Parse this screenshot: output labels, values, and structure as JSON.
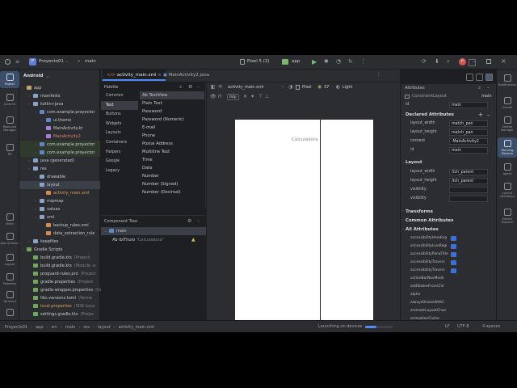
{
  "topbar": {
    "project": "Proyecto01",
    "branch": "main",
    "device": "Pixel 5 (2)",
    "run_config": "app"
  },
  "left_tools": [
    "Project",
    "Commit",
    "Resource Manager",
    "PR",
    "Build",
    "App Quality I",
    "Logcat",
    "Problems",
    "Terminal",
    "Version Control"
  ],
  "right_tools": [
    "Notifications",
    "Gradle",
    "Device Manager",
    "Running Devices",
    "Agent",
    "Layout Validation",
    "Device Explorer"
  ],
  "project_panel": {
    "view": "Android",
    "items": [
      {
        "label": "app",
        "indent": 0,
        "icon": "fld-y"
      },
      {
        "label": "manifests",
        "indent": 1,
        "icon": "fld"
      },
      {
        "label": "kotlin+java",
        "indent": 1,
        "icon": "fld"
      },
      {
        "label": "com.example.proyector",
        "indent": 2,
        "icon": "pkg"
      },
      {
        "label": "ui.theme",
        "indent": 3,
        "icon": "pkg"
      },
      {
        "label": "MainActivity.kt",
        "indent": 3,
        "icon": "fkt"
      },
      {
        "label": "MainActivity2",
        "indent": 3,
        "icon": "fkt",
        "highlight": "red"
      },
      {
        "label": "com.example.proyector",
        "indent": 2,
        "icon": "pkg",
        "highlight": "green"
      },
      {
        "label": "com.example.proyector",
        "indent": 2,
        "icon": "pkg",
        "highlight": "green"
      },
      {
        "label": "java (generated)",
        "indent": 1,
        "icon": "fld"
      },
      {
        "label": "res",
        "indent": 1,
        "icon": "fld"
      },
      {
        "label": "drawable",
        "indent": 2,
        "icon": "fld"
      },
      {
        "label": "layout",
        "indent": 2,
        "icon": "fld",
        "selected": true
      },
      {
        "label": "activity_main.xml",
        "indent": 3,
        "icon": "fxml",
        "color": "orange"
      },
      {
        "label": "mipmap",
        "indent": 2,
        "icon": "fld"
      },
      {
        "label": "values",
        "indent": 2,
        "icon": "fld"
      },
      {
        "label": "xml",
        "indent": 2,
        "icon": "fld"
      },
      {
        "label": "backup_rules.xml",
        "indent": 3,
        "icon": "fxml"
      },
      {
        "label": "data_extraction_rule",
        "indent": 3,
        "icon": "fxml"
      },
      {
        "label": "keepfiles",
        "indent": 1,
        "icon": "fld"
      },
      {
        "label": "Gradle Scripts",
        "indent": 0,
        "icon": "fgr"
      },
      {
        "label": "build.gradle.kts",
        "indent": 1,
        "icon": "fgr",
        "note": "(Project:"
      },
      {
        "label": "build.gradle.kts",
        "indent": 1,
        "icon": "fgr",
        "note": "(Module :a"
      },
      {
        "label": "proguard-rules.pro",
        "indent": 1,
        "icon": "fgr",
        "note": "(Project"
      },
      {
        "label": "gradle.properties",
        "indent": 1,
        "icon": "fgr",
        "note": "(Project"
      },
      {
        "label": "gradle-wrapper.properties",
        "indent": 1,
        "icon": "fgr",
        "note": "(Gr"
      },
      {
        "label": "libs.versions.toml",
        "indent": 1,
        "icon": "fgr",
        "note": "(Versio"
      },
      {
        "label": "local.properties",
        "indent": 1,
        "icon": "fgr",
        "note": "(SDK Loca",
        "color": "orange"
      },
      {
        "label": "settings.gradle.kts",
        "indent": 1,
        "icon": "fgr",
        "note": "(Projec"
      }
    ]
  },
  "tabs": [
    {
      "label": "activity_main.xml",
      "active": true
    },
    {
      "label": "MainActivity2.java",
      "active": false
    }
  ],
  "palette": {
    "title": "Palette",
    "categories": [
      "Common",
      "Text",
      "Buttons",
      "Widgets",
      "Layouts",
      "Containers",
      "Helpers",
      "Google",
      "Legacy"
    ],
    "active_category": 1,
    "items": [
      "Ab TextView",
      "Plain Text",
      "Password",
      "Password (Numeric)",
      "E-mail",
      "Phone",
      "Postal Address",
      "Multiline Text",
      "Time",
      "Date",
      "Number",
      "Number (Signed)",
      "Number (Decimal)"
    ]
  },
  "design_toolbar": {
    "file": "activity_main.xml",
    "device": "Pixel",
    "api": "37",
    "theme": "Light",
    "margin": "0dp"
  },
  "component_tree": {
    "title": "Component Tree",
    "root": "main",
    "child_label": "Ab lblTitulo",
    "child_text": "\"Calculadora\""
  },
  "canvas": {
    "label_text": "Calculadora"
  },
  "attributes": {
    "title": "Attributes",
    "class_name": "ConstraintLayout",
    "class_id": "main",
    "id_label": "id",
    "id_value": "main",
    "declared_title": "Declared Attributes",
    "declared": [
      {
        "name": "layout_width",
        "value": "match_pan"
      },
      {
        "name": "layout_height",
        "value": "match_pan"
      },
      {
        "name": "context",
        "value": ".MainActivity2"
      },
      {
        "name": "id",
        "value": "main"
      }
    ],
    "layout_title": "Layout",
    "layout": [
      {
        "name": "layout_width",
        "value": "/tch_parent"
      },
      {
        "name": "layout_height",
        "value": "/tch_parent"
      },
      {
        "name": "visibility",
        "value": ""
      },
      {
        "name": "visibility",
        "value": ""
      }
    ],
    "transforms": "Transforms",
    "common": "Common Attributes",
    "all": "All Attributes",
    "all_items": [
      "accessibilityHeading",
      "accessibilityLiveRegi",
      "accessibilityPaneTitle",
      "accessibilityTravers",
      "accessibilityTravers",
      "actionBarNavMode",
      "addStatesFromChil",
      "alpha",
      "alwaysDrawnWithC",
      "animateLayoutChan",
      "animationCache"
    ]
  },
  "statusbar": {
    "breadcrumb": [
      "Proyecto01",
      "app",
      "src",
      "main",
      "res",
      "layout",
      "activity_main.xml"
    ],
    "launch": "Launching on devices",
    "encoding": "LF",
    "charset": "UTF-8",
    "indent": "4 spaces"
  }
}
